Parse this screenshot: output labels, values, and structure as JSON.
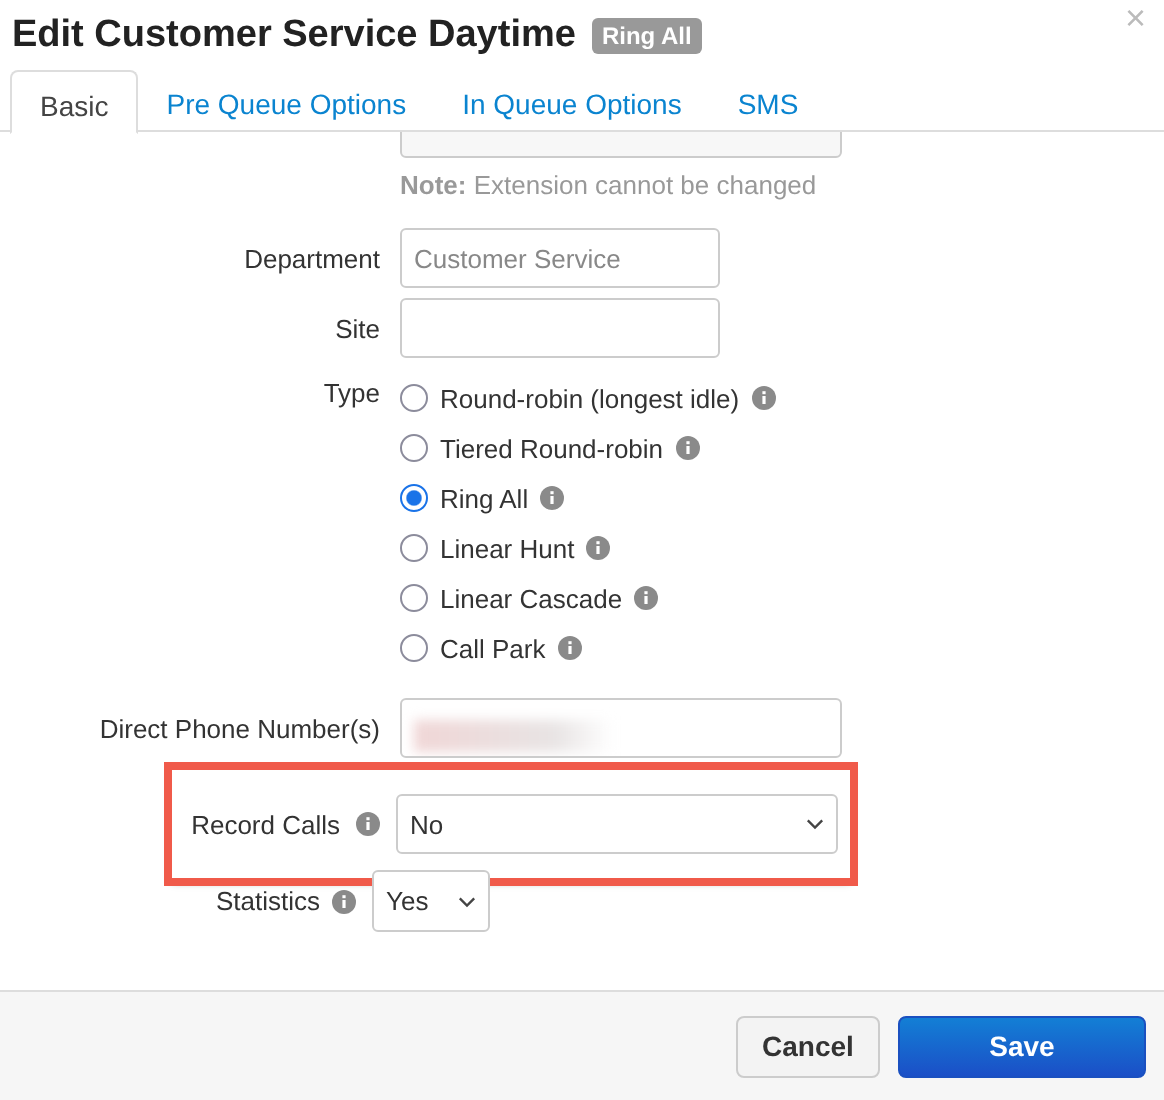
{
  "dialog": {
    "title": "Edit Customer Service Daytime",
    "badge": "Ring All",
    "close": "×"
  },
  "tabs": [
    {
      "label": "Basic",
      "selected": true
    },
    {
      "label": "Pre Queue Options",
      "selected": false
    },
    {
      "label": "In Queue Options",
      "selected": false
    },
    {
      "label": "SMS",
      "selected": false
    }
  ],
  "extension": {
    "note_label": "Note:",
    "note": "Extension cannot be changed"
  },
  "department": {
    "label": "Department",
    "placeholder": "Customer Service"
  },
  "site": {
    "label": "Site"
  },
  "type": {
    "label": "Type",
    "options": [
      {
        "label": "Round-robin (longest idle)",
        "selected": false
      },
      {
        "label": "Tiered Round-robin",
        "selected": false
      },
      {
        "label": "Ring All",
        "selected": true
      },
      {
        "label": "Linear Hunt",
        "selected": false
      },
      {
        "label": "Linear Cascade",
        "selected": false
      },
      {
        "label": "Call Park",
        "selected": false
      }
    ]
  },
  "direct_phone": {
    "label": "Direct Phone Number(s)",
    "redacted": true
  },
  "record_calls": {
    "label": "Record Calls",
    "value": "No",
    "highlighted": true
  },
  "statistics": {
    "label": "Statistics",
    "value": "Yes",
    "highlighted": false
  },
  "buttons": [
    {
      "label": "Cancel",
      "kind": "secondary"
    },
    {
      "label": "Save",
      "kind": "primary"
    }
  ]
}
